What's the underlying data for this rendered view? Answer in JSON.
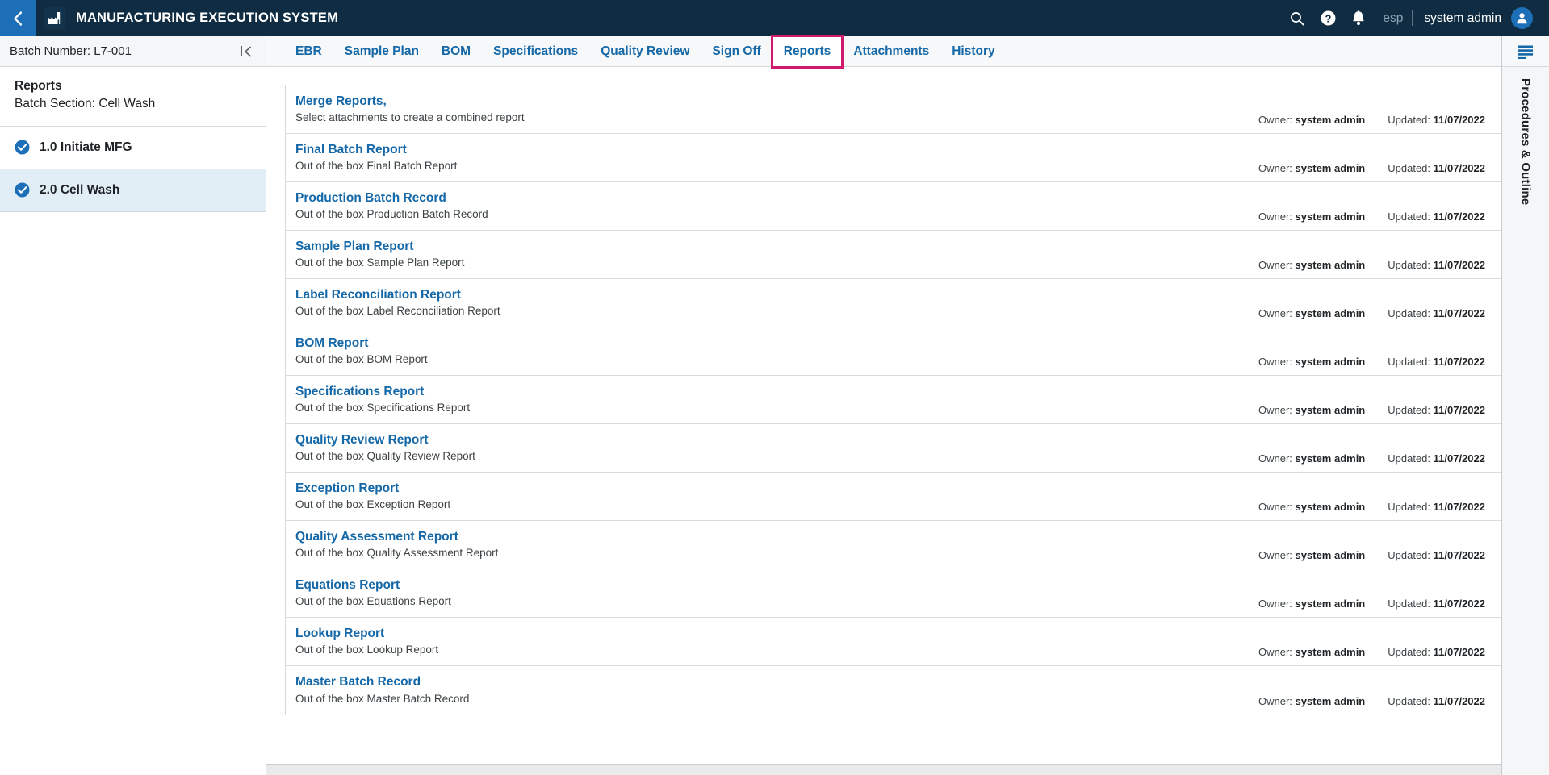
{
  "colors": {
    "topbar_bg": "#0f2c42",
    "accent_blue": "#1568a8",
    "back_tile_blue": "#1d70b8",
    "highlight_pink": "#cf1a6d",
    "active_row_bg": "#e2eef6"
  },
  "topbar": {
    "back_icon": "chevron-left-icon",
    "logo_icon": "factory-icon",
    "title": "MANUFACTURING EXECUTION SYSTEM",
    "search_icon": "search-icon",
    "help_icon": "help-circle-icon",
    "notifications_icon": "bell-icon",
    "language": "esp",
    "user_name": "system admin",
    "avatar_icon": "user-avatar-icon"
  },
  "sidebar": {
    "batch_label": "Batch Number: L7-001",
    "collapse_icon": "collapse-panel-icon",
    "section_title": "Reports",
    "section_subtitle": "Batch Section: Cell Wash",
    "items": [
      {
        "label": "1.0 Initiate MFG",
        "status_icon": "check-circle-icon",
        "active": false
      },
      {
        "label": "2.0 Cell Wash",
        "status_icon": "check-circle-icon",
        "active": true
      }
    ]
  },
  "tabs": [
    {
      "label": "EBR",
      "highlighted": false
    },
    {
      "label": "Sample Plan",
      "highlighted": false
    },
    {
      "label": "BOM",
      "highlighted": false
    },
    {
      "label": "Specifications",
      "highlighted": false
    },
    {
      "label": "Quality Review",
      "highlighted": false
    },
    {
      "label": "Sign Off",
      "highlighted": false
    },
    {
      "label": "Reports",
      "highlighted": true
    },
    {
      "label": "Attachments",
      "highlighted": false
    },
    {
      "label": "History",
      "highlighted": false
    }
  ],
  "reports_list": {
    "owner_prefix": "Owner:",
    "updated_prefix": "Updated:",
    "rows": [
      {
        "title": "Merge Reports,",
        "description": "Select attachments to create a combined report",
        "owner": "system admin",
        "updated": "11/07/2022"
      },
      {
        "title": "Final Batch Report",
        "description": "Out of the box Final Batch Report",
        "owner": "system admin",
        "updated": "11/07/2022"
      },
      {
        "title": "Production Batch Record",
        "description": "Out of the box Production Batch Record",
        "owner": "system admin",
        "updated": "11/07/2022"
      },
      {
        "title": "Sample Plan Report",
        "description": "Out of the box Sample Plan Report",
        "owner": "system admin",
        "updated": "11/07/2022"
      },
      {
        "title": "Label Reconciliation Report",
        "description": "Out of the box Label Reconciliation Report",
        "owner": "system admin",
        "updated": "11/07/2022"
      },
      {
        "title": "BOM Report",
        "description": "Out of the box BOM Report",
        "owner": "system admin",
        "updated": "11/07/2022"
      },
      {
        "title": "Specifications Report",
        "description": "Out of the box Specifications Report",
        "owner": "system admin",
        "updated": "11/07/2022"
      },
      {
        "title": "Quality Review Report",
        "description": "Out of the box Quality Review Report",
        "owner": "system admin",
        "updated": "11/07/2022"
      },
      {
        "title": "Exception Report",
        "description": "Out of the box Exception Report",
        "owner": "system admin",
        "updated": "11/07/2022"
      },
      {
        "title": "Quality Assessment Report",
        "description": "Out of the box Quality Assessment Report",
        "owner": "system admin",
        "updated": "11/07/2022"
      },
      {
        "title": "Equations Report",
        "description": "Out of the box Equations Report",
        "owner": "system admin",
        "updated": "11/07/2022"
      },
      {
        "title": "Lookup Report",
        "description": "Out of the box Lookup Report",
        "owner": "system admin",
        "updated": "11/07/2022"
      },
      {
        "title": "Master Batch Record",
        "description": "Out of the box Master Batch Record",
        "owner": "system admin",
        "updated": "11/07/2022"
      }
    ]
  },
  "right_rail": {
    "menu_icon": "hamburger-menu-icon",
    "label": "Procedures & Outline"
  }
}
